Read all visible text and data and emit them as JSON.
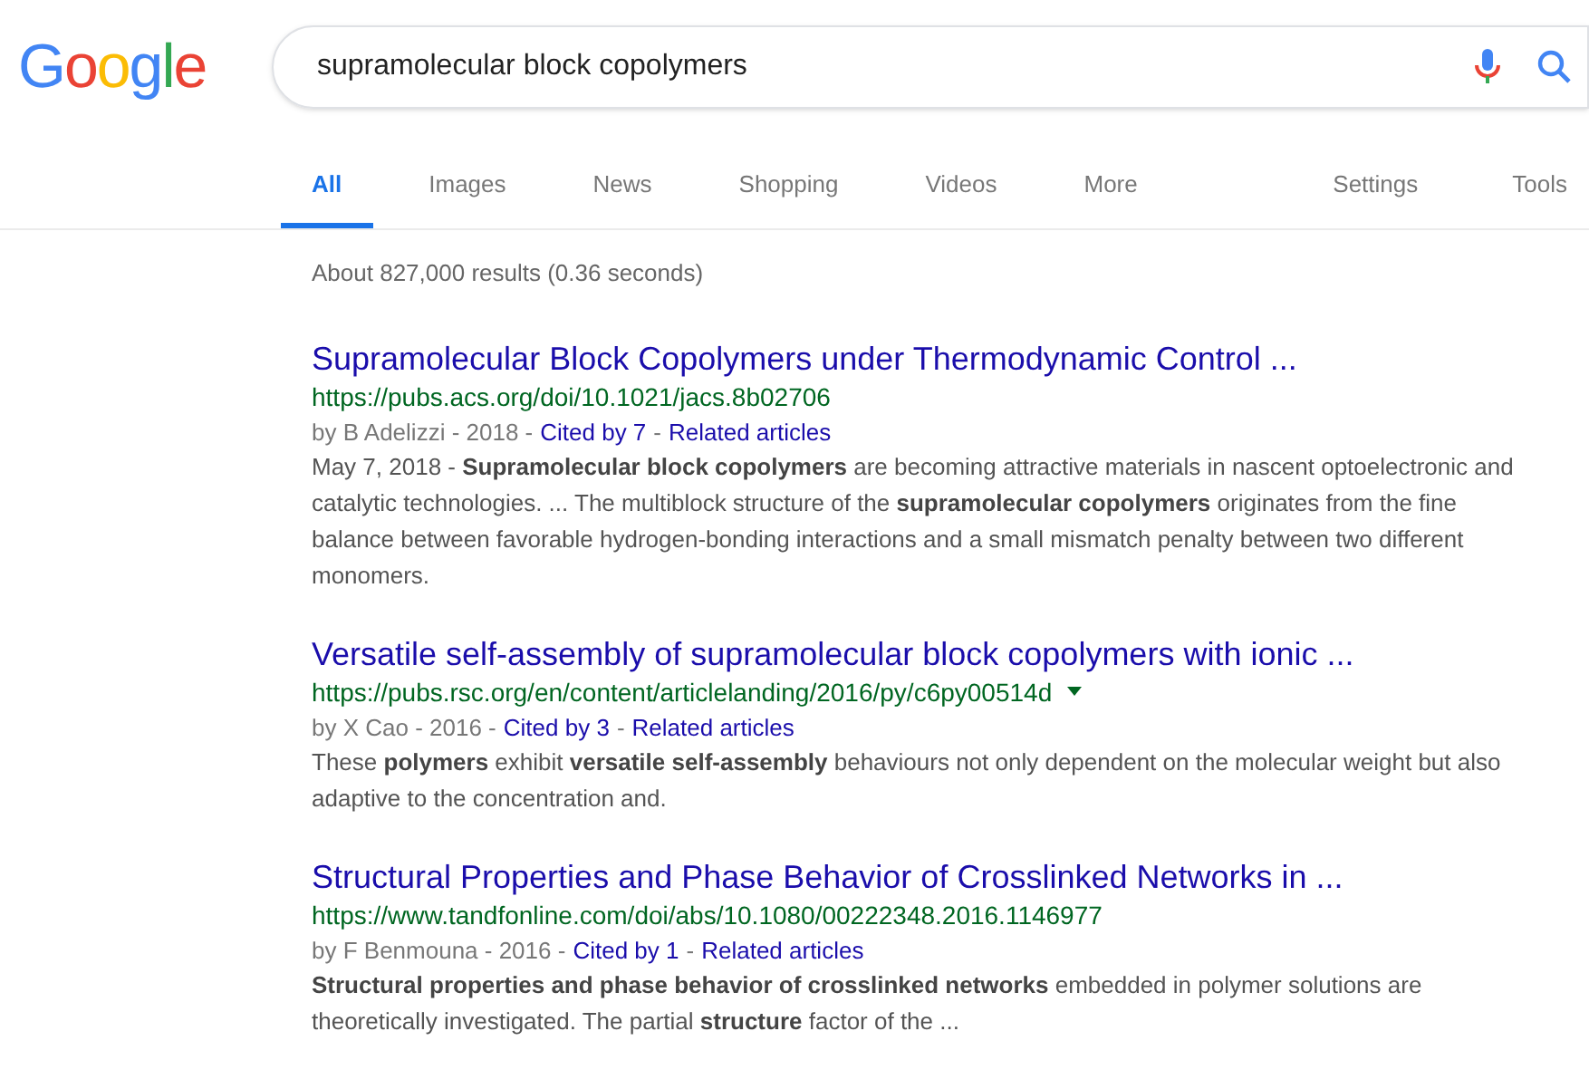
{
  "logo": "Google",
  "search": {
    "value": "supramolecular block copolymers"
  },
  "tabs": [
    {
      "label": "All",
      "selected": true
    },
    {
      "label": "Images",
      "selected": false
    },
    {
      "label": "News",
      "selected": false
    },
    {
      "label": "Shopping",
      "selected": false
    },
    {
      "label": "Videos",
      "selected": false
    },
    {
      "label": "More",
      "selected": false
    }
  ],
  "tools": [
    "Settings",
    "Tools"
  ],
  "result_stats": "About 827,000 results (0.36 seconds)",
  "results": [
    {
      "title": "Supramolecular Block Copolymers under Thermodynamic Control ...",
      "url": "https://pubs.acs.org/doi/10.1021/jacs.8b02706",
      "url_menu": false,
      "meta": [
        {
          "kind": "plain",
          "text": "by B Adelizzi - 2018 -"
        },
        {
          "kind": "link",
          "text": "Cited by 7"
        },
        {
          "kind": "plain",
          "text": "-"
        },
        {
          "kind": "link",
          "text": "Related articles"
        }
      ],
      "snippet": "May 7, 2018 - **Supramolecular block copolymers** are becoming attractive materials in nascent optoelectronic and catalytic technologies. ... The multiblock structure of the **supramolecular copolymers** originates from the fine balance between favorable hydrogen-bonding interactions and a small mismatch penalty between two different monomers."
    },
    {
      "title": "Versatile self-assembly of supramolecular block copolymers with ionic ...",
      "url": "https://pubs.rsc.org/en/content/articlelanding/2016/py/c6py00514d",
      "url_menu": true,
      "meta": [
        {
          "kind": "plain",
          "text": "by X Cao - 2016 -"
        },
        {
          "kind": "link",
          "text": "Cited by 3"
        },
        {
          "kind": "plain",
          "text": "-"
        },
        {
          "kind": "link",
          "text": "Related articles"
        }
      ],
      "snippet": "These **polymers** exhibit **versatile self-assembly** behaviours not only dependent on the molecular weight but also adaptive to the concentration and."
    },
    {
      "title": "Structural Properties and Phase Behavior of Crosslinked Networks in ...",
      "url": "https://www.tandfonline.com/doi/abs/10.1080/00222348.2016.1146977",
      "url_menu": false,
      "meta": [
        {
          "kind": "plain",
          "text": "by F Benmouna - 2016 -"
        },
        {
          "kind": "link",
          "text": "Cited by 1"
        },
        {
          "kind": "plain",
          "text": "-"
        },
        {
          "kind": "link",
          "text": "Related articles"
        }
      ],
      "snippet": "**Structural properties and phase behavior of crosslinked networks** embedded in polymer solutions are theoretically investigated. The partial **structure** factor of the ..."
    }
  ]
}
